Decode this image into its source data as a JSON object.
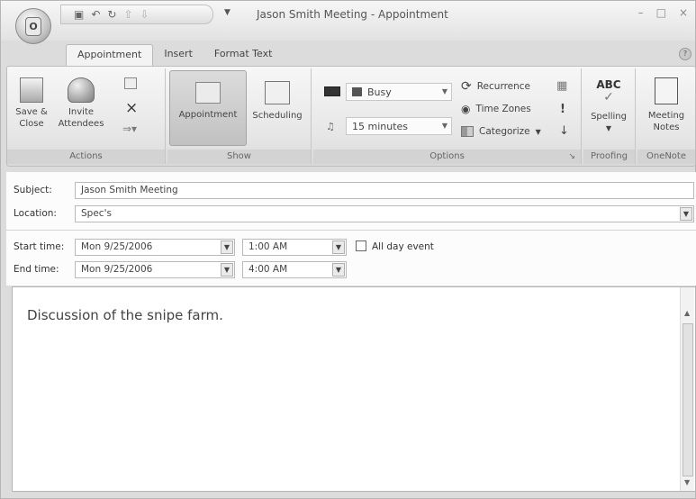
{
  "window": {
    "title": "Jason Smith Meeting - Appointment",
    "office_button_label": "O"
  },
  "quick_access": [
    "save-icon",
    "undo-icon",
    "redo-icon",
    "up-arrow-icon",
    "down-arrow-icon"
  ],
  "tabs": [
    {
      "label": "Appointment",
      "active": true
    },
    {
      "label": "Insert",
      "active": false
    },
    {
      "label": "Format Text",
      "active": false
    }
  ],
  "ribbon": {
    "actions": {
      "label": "Actions",
      "save_close": "Save &",
      "save_close_2": "Close",
      "invite": "Invite",
      "invite_2": "Attendees"
    },
    "show": {
      "label": "Show",
      "appointment": "Appointment",
      "scheduling": "Scheduling"
    },
    "options": {
      "label": "Options",
      "show_as": "Busy",
      "reminder": "15 minutes",
      "recurrence": "Recurrence",
      "time_zones": "Time Zones",
      "categorize": "Categorize"
    },
    "proofing": {
      "label": "Proofing",
      "spelling": "Spelling",
      "spelling_icon_text": "ABC"
    },
    "onenote": {
      "label": "OneNote",
      "notes_1": "Meeting",
      "notes_2": "Notes"
    }
  },
  "form": {
    "subject_label": "Subject:",
    "subject_value": "Jason Smith Meeting",
    "location_label": "Location:",
    "location_value": "Spec's",
    "start_label": "Start time:",
    "start_date": "Mon 9/25/2006",
    "start_time": "1:00 AM",
    "all_day_label": "All day event",
    "end_label": "End time:",
    "end_date": "Mon 9/25/2006",
    "end_time": "4:00 AM"
  },
  "body": {
    "text": "Discussion of the snipe farm."
  }
}
